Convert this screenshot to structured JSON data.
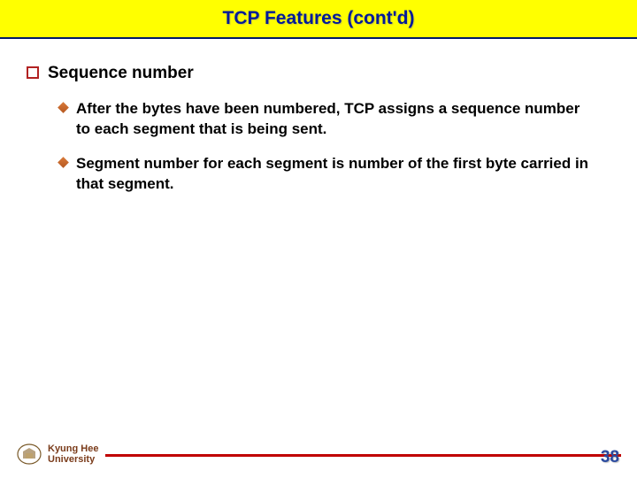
{
  "title": "TCP Features (cont'd)",
  "main_bullet": "Sequence number",
  "sub_bullets": [
    "After the bytes have been numbered, TCP assigns a sequence number to each segment that is being sent.",
    "Segment number for each segment is number of the first byte carried in that segment."
  ],
  "footer": {
    "line1": "Kyung Hee",
    "line2": "University"
  },
  "page_number": "38"
}
